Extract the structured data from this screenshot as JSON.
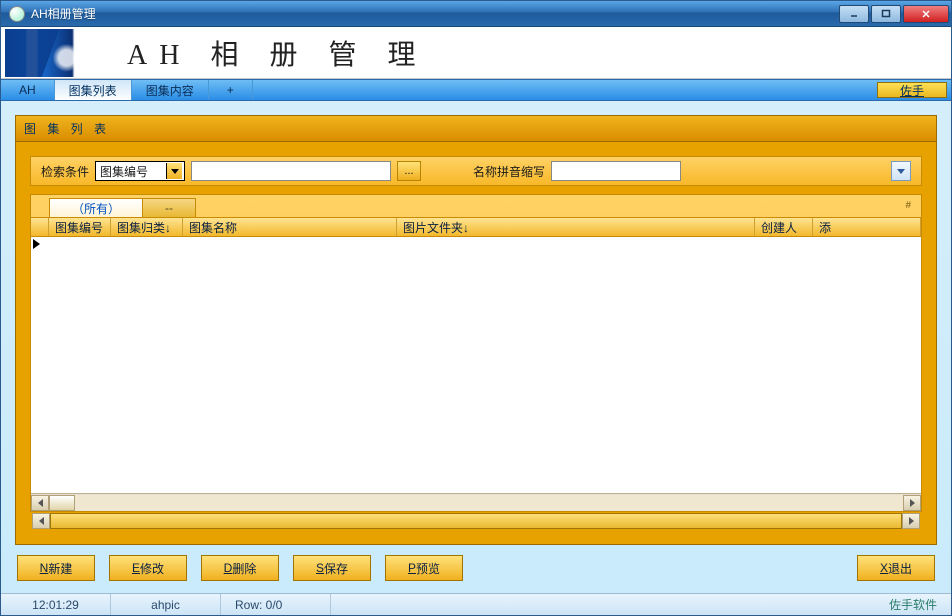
{
  "window": {
    "title": "AH相册管理"
  },
  "banner": {
    "title": "AH 相 册 管 理"
  },
  "tabs": {
    "ah": "AH",
    "list": "图集列表",
    "content": "图集内容",
    "plus": "+",
    "right": "佐手"
  },
  "panel": {
    "title": "图 集 列 表",
    "search": {
      "condition_label": "检索条件",
      "field_selected": "图集编号",
      "text_value": "",
      "ellipsis": "...",
      "pinyin_label": "名称拼音缩写",
      "pinyin_value": ""
    },
    "grid": {
      "tab_all": "（所有）",
      "tab_dash": "--",
      "hash": "#",
      "columns": {
        "c1": "图集编号",
        "c2": "图集归类↓",
        "c3": "图集名称",
        "c4": "图片文件夹↓",
        "c5": "创建人",
        "c6": "添"
      }
    }
  },
  "buttons": {
    "new": {
      "k": "N",
      "t": " 新建"
    },
    "edit": {
      "k": "E",
      "t": " 修改"
    },
    "del": {
      "k": "D",
      "t": " 删除"
    },
    "save": {
      "k": "S",
      "t": " 保存"
    },
    "preview": {
      "k": "P",
      "t": " 预览"
    },
    "exit": {
      "k": "X",
      "t": " 退出"
    }
  },
  "status": {
    "time": "12:01:29",
    "app": "ahpic",
    "row": "Row: 0/0",
    "brand": "佐手软件"
  }
}
